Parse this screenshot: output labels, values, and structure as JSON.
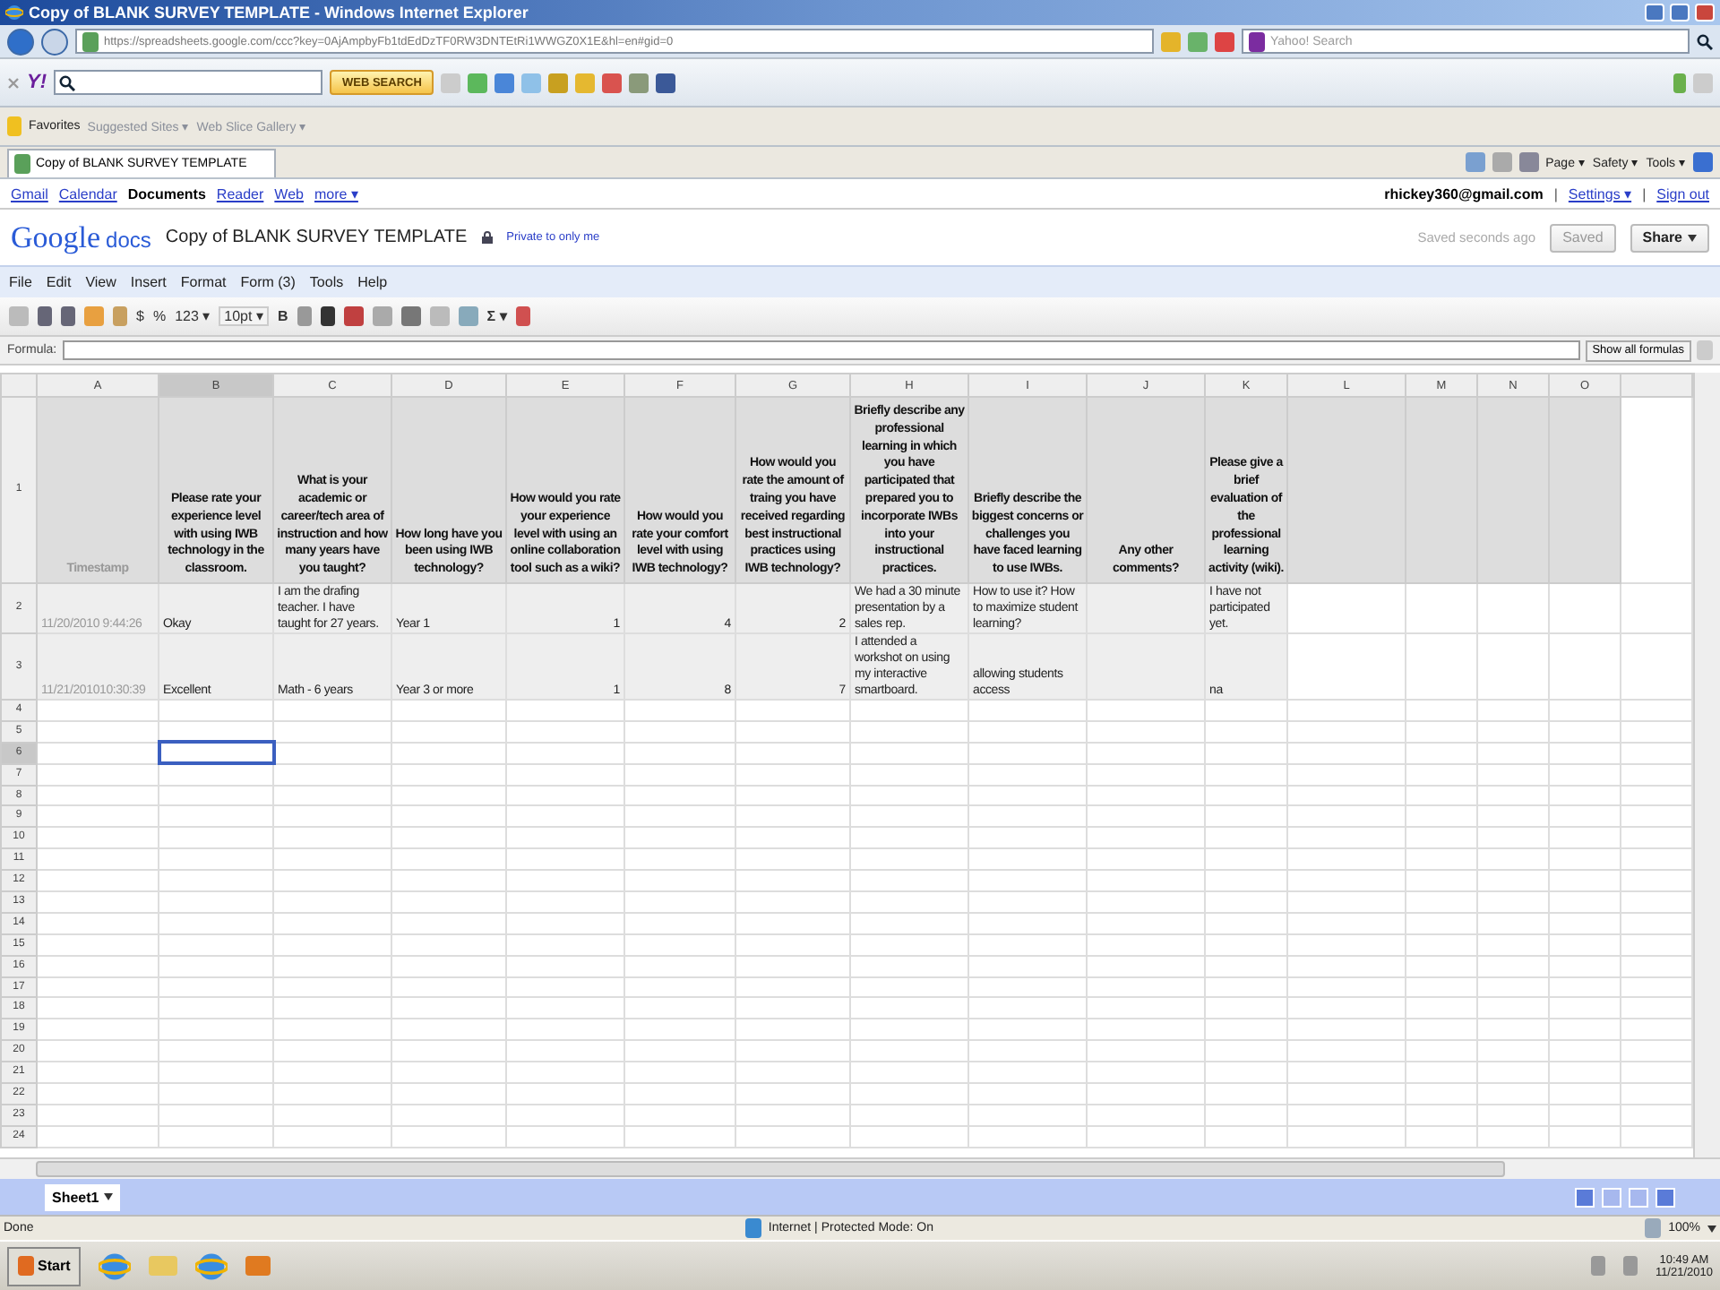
{
  "browser": {
    "title": "Copy of BLANK SURVEY TEMPLATE - Windows Internet Explorer",
    "url": "https://spreadsheets.google.com/ccc?key=0AjAmpbyFb1tdEdDzTF0RW3DNTEtRi1WWGZ0X1E&hl=en#gid=0",
    "search_placeholder": "Yahoo! Search",
    "toolbar_logo": "Y!",
    "toolbar_search_button": "WEB SEARCH",
    "favorites": [
      "Favorites",
      "Suggested Sites ▾",
      "Web Slice Gallery ▾"
    ],
    "tab": "Copy of BLANK SURVEY TEMPLATE",
    "commands": [
      "Page ▾",
      "Safety ▾",
      "Tools ▾"
    ]
  },
  "google_bar": {
    "links": [
      {
        "label": "Gmail",
        "selected": false
      },
      {
        "label": "Calendar",
        "selected": false
      },
      {
        "label": "Documents",
        "selected": true
      },
      {
        "label": "Reader",
        "selected": false
      },
      {
        "label": "Web",
        "selected": false
      },
      {
        "label": "more ▾",
        "selected": false
      }
    ],
    "account": "rhickey360@gmail.com",
    "separators": [
      "|",
      "|"
    ],
    "settings": "Settings ▾",
    "sign_out": "Sign out"
  },
  "doc": {
    "logo_brand": "Google",
    "logo_product": "docs",
    "title": "Copy of BLANK SURVEY TEMPLATE",
    "privacy": "Private to only me",
    "save_status": "Saved seconds ago",
    "saved_button": "Saved",
    "share_button": "Share"
  },
  "menu": [
    "File",
    "Edit",
    "View",
    "Insert",
    "Format",
    "Form (3)",
    "Tools",
    "Help"
  ],
  "toolbar": {
    "currency": "$",
    "percent": "%",
    "number_format": "123 ▾",
    "font_size": "10pt ▾",
    "bold": "B",
    "sum": "Σ ▾"
  },
  "formula_bar": {
    "label": "Formula:",
    "button": "Show all formulas"
  },
  "sheet": {
    "columns": [
      {
        "label": "A",
        "selected": false
      },
      {
        "label": "B",
        "selected": true
      },
      {
        "label": "C",
        "selected": false
      },
      {
        "label": "D",
        "selected": false
      },
      {
        "label": "E",
        "selected": false,
        "numeric": true
      },
      {
        "label": "F",
        "selected": false,
        "numeric": true
      },
      {
        "label": "G",
        "selected": false,
        "numeric": true
      },
      {
        "label": "H",
        "selected": false
      },
      {
        "label": "I",
        "selected": false
      },
      {
        "label": "J",
        "selected": false
      },
      {
        "label": "K",
        "selected": false
      },
      {
        "label": "L",
        "selected": false
      },
      {
        "label": "M",
        "selected": false
      },
      {
        "label": "N",
        "selected": false
      },
      {
        "label": "O",
        "selected": false
      }
    ],
    "rows": [
      {
        "number": "1",
        "kind": "header",
        "selected": false,
        "cells": [
          "Timestamp",
          "Please rate your experience level with using IWB technology in the classroom.",
          "What is your academic or career/tech area of instruction and how many years have you taught?",
          "How long have you been using IWB technology?",
          "How would you rate your experience level with using an online collaboration tool such as a wiki?",
          "How would you rate your comfort level with using IWB technology?",
          "How would you rate the amount of traing you have received regarding best instructional practices using IWB technology?",
          "Briefly describe any professional learning in which you have participated that prepared you to incorporate IWBs into your instructional practices.",
          "Briefly describe the biggest concerns or challenges you have faced learning to use IWBs.",
          "Any other comments?",
          "Please give a brief evaluation of the professional learning activity (wiki)."
        ]
      },
      {
        "number": "2",
        "kind": "data",
        "selected": false,
        "cells": [
          "11/20/2010 9:44:26",
          "Okay",
          "I am the drafing teacher. I have taught for 27 years.",
          "Year 1",
          "1",
          "4",
          "2",
          "We had a 30 minute presentation by a sales rep.",
          "How to use it? How to maximize student learning?",
          "",
          "I have not participated yet."
        ]
      },
      {
        "number": "3",
        "kind": "data",
        "selected": false,
        "cells": [
          "11/21/201010:30:39",
          "Excellent",
          "Math - 6 years",
          "Year 3 or more",
          "1",
          "8",
          "7",
          "I attended a workshot on using my interactive smartboard.",
          "allowing students access",
          "",
          "na"
        ]
      },
      {
        "number": "4",
        "kind": "data",
        "selected": false
      },
      {
        "number": "5",
        "kind": "data",
        "selected": false
      },
      {
        "number": "6",
        "kind": "data",
        "selected": true
      },
      {
        "number": "7",
        "kind": "data",
        "selected": false
      },
      {
        "number": "8",
        "kind": "data",
        "selected": false
      },
      {
        "number": "9",
        "kind": "data",
        "selected": false
      },
      {
        "number": "10",
        "kind": "data",
        "selected": false
      },
      {
        "number": "11",
        "kind": "data",
        "selected": false
      },
      {
        "number": "12",
        "kind": "data",
        "selected": false
      },
      {
        "number": "13",
        "kind": "data",
        "selected": false
      },
      {
        "number": "14",
        "kind": "data",
        "selected": false
      },
      {
        "number": "15",
        "kind": "data",
        "selected": false
      },
      {
        "number": "16",
        "kind": "data",
        "selected": false
      },
      {
        "number": "17",
        "kind": "data",
        "selected": false
      },
      {
        "number": "18",
        "kind": "data",
        "selected": false
      },
      {
        "number": "19",
        "kind": "data",
        "selected": false
      },
      {
        "number": "20",
        "kind": "data",
        "selected": false
      },
      {
        "number": "21",
        "kind": "data",
        "selected": false
      },
      {
        "number": "22",
        "kind": "data",
        "selected": false
      },
      {
        "number": "23",
        "kind": "data",
        "selected": false
      },
      {
        "number": "24",
        "kind": "data",
        "selected": false
      }
    ],
    "tabs": [
      {
        "label": "Sheet1",
        "selected": true
      }
    ]
  },
  "status_bar": {
    "text": "Done",
    "zone": "Internet | Protected Mode: On",
    "zoom": "100%"
  },
  "taskbar": {
    "start": "Start",
    "time": "10:49 AM",
    "date": "11/21/2010"
  }
}
